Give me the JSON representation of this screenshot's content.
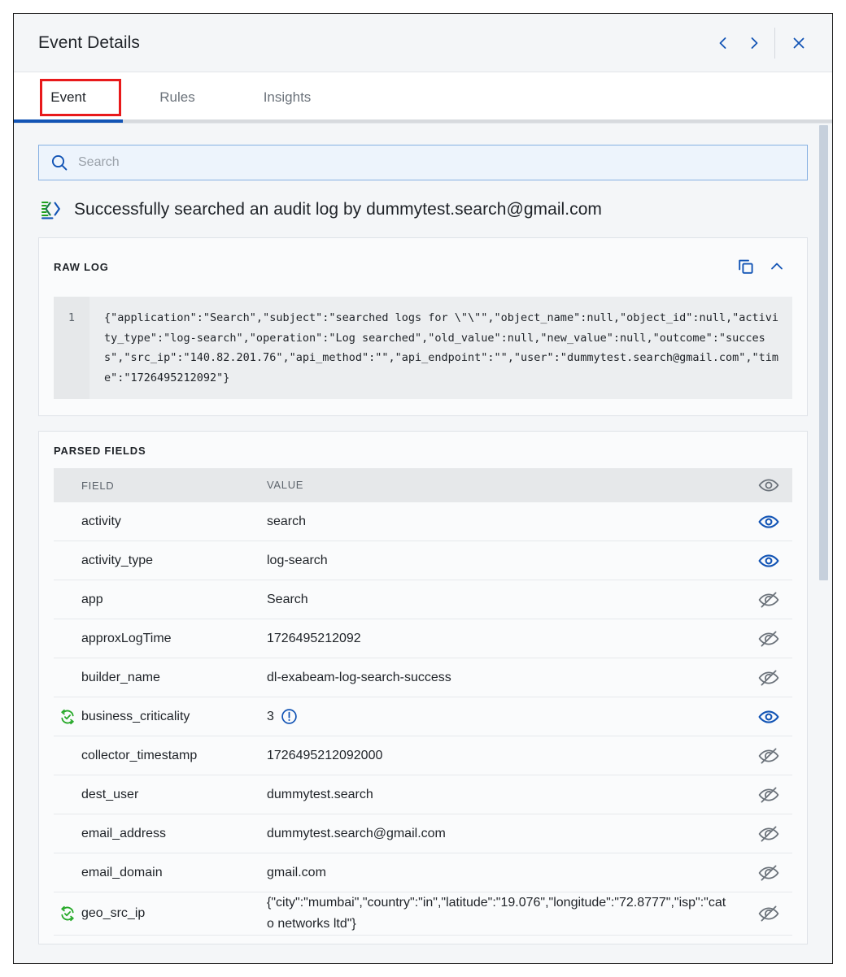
{
  "header": {
    "title": "Event Details",
    "prev_label": "‹",
    "next_label": "›",
    "close_label": "✕"
  },
  "tabs": [
    {
      "label": "Event",
      "active": true
    },
    {
      "label": "Rules",
      "active": false
    },
    {
      "label": "Insights",
      "active": false
    }
  ],
  "search": {
    "placeholder": "Search",
    "value": ""
  },
  "event": {
    "headline": "Successfully searched an audit log by dummytest.search@gmail.com"
  },
  "raw_log": {
    "title": "RAW LOG",
    "line_number": "1",
    "content": "{\"application\":\"Search\",\"subject\":\"searched logs for \\\"\\\"\",\"object_name\":null,\"object_id\":null,\"activity_type\":\"log-search\",\"operation\":\"Log searched\",\"old_value\":null,\"new_value\":null,\"outcome\":\"success\",\"src_ip\":\"140.82.201.76\",\"api_method\":\"\",\"api_endpoint\":\"\",\"user\":\"dummytest.search@gmail.com\",\"time\":\"1726495212092\"}"
  },
  "parsed_fields": {
    "title": "PARSED FIELDS",
    "columns": {
      "field": "FIELD",
      "value": "VALUE"
    },
    "rows": [
      {
        "field": "activity",
        "value": "search",
        "eye": "visible",
        "enriched": false,
        "info": false
      },
      {
        "field": "activity_type",
        "value": "log-search",
        "eye": "visible",
        "enriched": false,
        "info": false
      },
      {
        "field": "app",
        "value": "Search",
        "eye": "hidden",
        "enriched": false,
        "info": false
      },
      {
        "field": "approxLogTime",
        "value": "1726495212092",
        "eye": "hidden",
        "enriched": false,
        "info": false
      },
      {
        "field": "builder_name",
        "value": "dl-exabeam-log-search-success",
        "eye": "hidden",
        "enriched": false,
        "info": false
      },
      {
        "field": "business_criticality",
        "value": "3",
        "eye": "visible",
        "enriched": true,
        "info": true
      },
      {
        "field": "collector_timestamp",
        "value": "1726495212092000",
        "eye": "hidden",
        "enriched": false,
        "info": false
      },
      {
        "field": "dest_user",
        "value": "dummytest.search",
        "eye": "hidden",
        "enriched": false,
        "info": false
      },
      {
        "field": "email_address",
        "value": "dummytest.search@gmail.com",
        "eye": "hidden",
        "enriched": false,
        "info": false
      },
      {
        "field": "email_domain",
        "value": "gmail.com",
        "eye": "hidden",
        "enriched": false,
        "info": false
      },
      {
        "field": "geo_src_ip",
        "value": "{\"city\":\"mumbai\",\"country\":\"in\",\"latitude\":\"19.076\",\"longitude\":\"72.8777\",\"isp\":\"cato networks ltd\"}",
        "eye": "hidden",
        "enriched": true,
        "info": false
      }
    ]
  },
  "colors": {
    "accent_blue": "#1254b5",
    "enrich_green": "#26a928",
    "highlight_red": "#e8191b",
    "eye_on": "#1254b5",
    "eye_off": "#6b727a"
  }
}
